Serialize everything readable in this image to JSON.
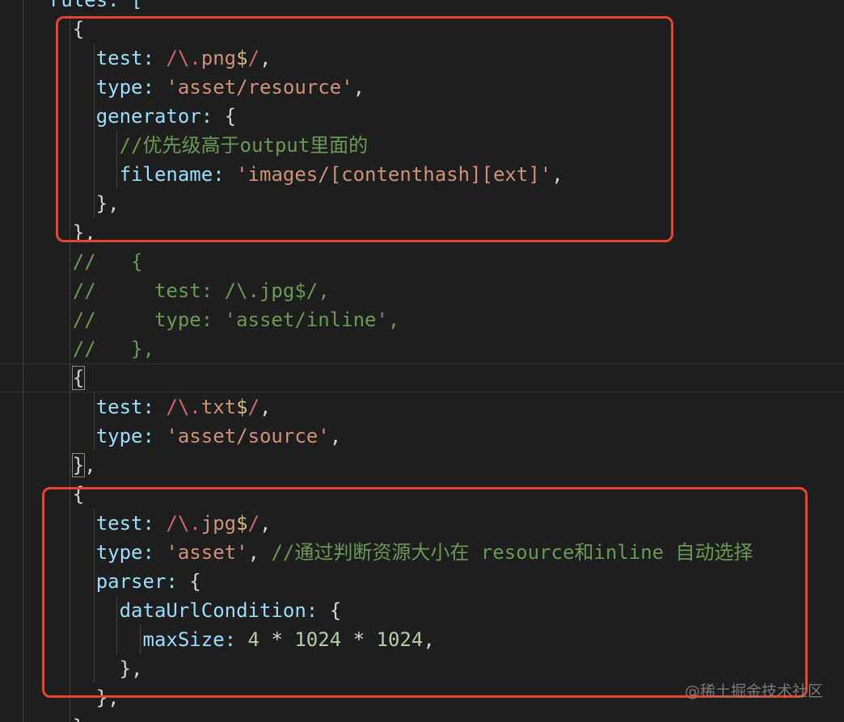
{
  "lines": [
    [
      {
        "t": "  rules: [",
        "c": "k"
      }
    ],
    [
      {
        "t": "    {",
        "c": "p"
      }
    ],
    [
      {
        "t": "      test: ",
        "c": "k"
      },
      {
        "t": "/\\.",
        "c": "r"
      },
      {
        "t": "png",
        "c": "s"
      },
      {
        "t": "$",
        "c": "rr"
      },
      {
        "t": "/",
        "c": "r"
      },
      {
        "t": ",",
        "c": "p"
      }
    ],
    [
      {
        "t": "      type: ",
        "c": "k"
      },
      {
        "t": "'asset/resource'",
        "c": "s"
      },
      {
        "t": ",",
        "c": "p"
      }
    ],
    [
      {
        "t": "      generator: ",
        "c": "k"
      },
      {
        "t": "{",
        "c": "p"
      }
    ],
    [
      {
        "t": "        //优先级高于output里面的",
        "c": "c"
      }
    ],
    [
      {
        "t": "        filename: ",
        "c": "k"
      },
      {
        "t": "'images/[contenthash][ext]'",
        "c": "s"
      },
      {
        "t": ",",
        "c": "p"
      }
    ],
    [
      {
        "t": "      },",
        "c": "p"
      }
    ],
    [
      {
        "t": "    },",
        "c": "p"
      }
    ],
    [
      {
        "t": "    //   {",
        "c": "c"
      }
    ],
    [
      {
        "t": "    //     test: /\\.jpg$/,",
        "c": "c"
      }
    ],
    [
      {
        "t": "    //     type: 'asset/inline',",
        "c": "c"
      }
    ],
    [
      {
        "t": "    //   },",
        "c": "c"
      }
    ],
    [
      {
        "t": "    ",
        "c": "p"
      },
      {
        "t": "{",
        "c": "p",
        "m": true
      }
    ],
    [
      {
        "t": "      test: ",
        "c": "k"
      },
      {
        "t": "/\\.",
        "c": "r"
      },
      {
        "t": "txt",
        "c": "s"
      },
      {
        "t": "$",
        "c": "rr"
      },
      {
        "t": "/",
        "c": "r"
      },
      {
        "t": ",",
        "c": "p"
      }
    ],
    [
      {
        "t": "      type: ",
        "c": "k"
      },
      {
        "t": "'asset/source'",
        "c": "s"
      },
      {
        "t": ",",
        "c": "p"
      }
    ],
    [
      {
        "t": "    ",
        "c": "p"
      },
      {
        "t": "}",
        "c": "p",
        "m": true
      },
      {
        "t": ",",
        "c": "p"
      }
    ],
    [
      {
        "t": "    {",
        "c": "p"
      }
    ],
    [
      {
        "t": "      test: ",
        "c": "k"
      },
      {
        "t": "/\\.",
        "c": "r"
      },
      {
        "t": "jpg",
        "c": "s"
      },
      {
        "t": "$",
        "c": "rr"
      },
      {
        "t": "/",
        "c": "r"
      },
      {
        "t": ",",
        "c": "p"
      }
    ],
    [
      {
        "t": "      type: ",
        "c": "k"
      },
      {
        "t": "'asset'",
        "c": "s"
      },
      {
        "t": ", ",
        "c": "p"
      },
      {
        "t": "//通过判断资源大小在 resource和inline 自动选择",
        "c": "c"
      }
    ],
    [
      {
        "t": "      parser: ",
        "c": "k"
      },
      {
        "t": "{",
        "c": "p"
      }
    ],
    [
      {
        "t": "        dataUrlCondition: ",
        "c": "k"
      },
      {
        "t": "{",
        "c": "p"
      }
    ],
    [
      {
        "t": "          maxSize: ",
        "c": "k"
      },
      {
        "t": "4",
        "c": "n"
      },
      {
        "t": " * ",
        "c": "p"
      },
      {
        "t": "1024",
        "c": "n"
      },
      {
        "t": " * ",
        "c": "p"
      },
      {
        "t": "1024",
        "c": "n"
      },
      {
        "t": ",",
        "c": "p"
      }
    ],
    [
      {
        "t": "        },",
        "c": "p"
      }
    ],
    [
      {
        "t": "      },",
        "c": "p"
      }
    ],
    [
      {
        "t": "    },",
        "c": "p"
      }
    ]
  ],
  "watermark": "@稀土掘金技术社区",
  "colors": {
    "background": "#1e1e1e",
    "highlight_box": "#e8432f",
    "property": "#9cdcfe",
    "string": "#ce9178",
    "regex": "#d16969",
    "comment": "#6a9955",
    "number": "#b5cea8"
  }
}
